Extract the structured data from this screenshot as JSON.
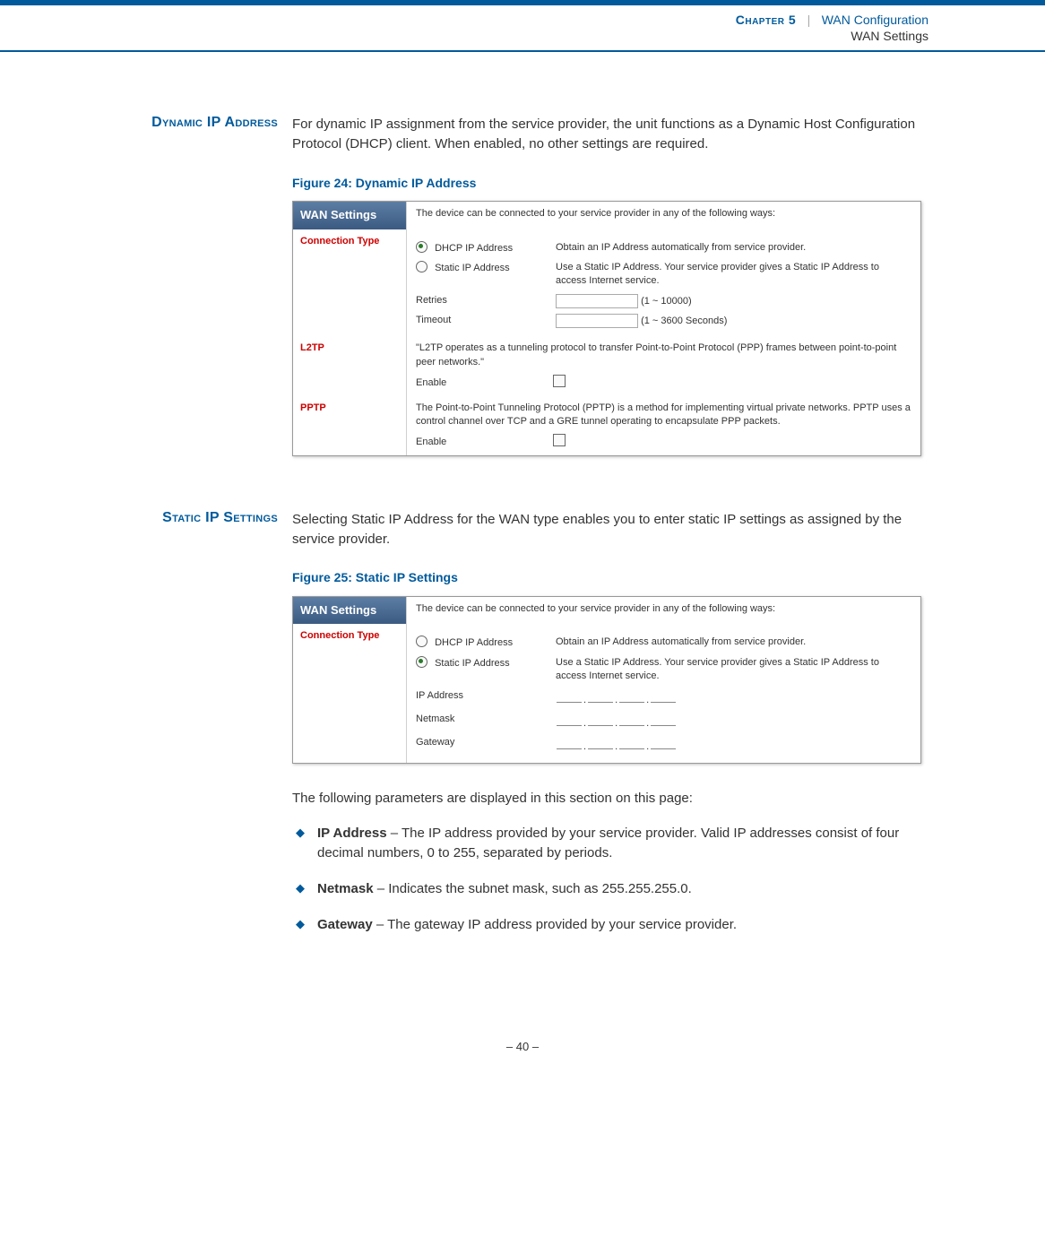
{
  "header": {
    "chapter": "Chapter 5",
    "separator": "|",
    "title1": "WAN Configuration",
    "title2": "WAN Settings"
  },
  "sec1": {
    "heading": "Dynamic IP Address",
    "body": "For dynamic IP assignment from the service provider, the unit functions as a Dynamic Host Configuration Protocol (DHCP) client. When enabled, no other settings are required.",
    "figcap": "Figure 24:  Dynamic IP Address"
  },
  "ss1": {
    "title": "WAN Settings",
    "intro": "The device can be connected to your service provider in any of the following ways:",
    "conn_label": "Connection Type",
    "dhcp_label": "DHCP IP Address",
    "dhcp_desc": "Obtain an IP Address automatically from service provider.",
    "static_label": "Static IP Address",
    "static_desc": "Use a Static IP Address. Your service provider gives a Static IP Address to access Internet service.",
    "retries_label": "Retries",
    "retries_hint": "(1 ~ 10000)",
    "timeout_label": "Timeout",
    "timeout_hint": "(1 ~ 3600 Seconds)",
    "l2tp_label": "L2TP",
    "l2tp_desc": "\"L2TP operates as a tunneling protocol to transfer Point-to-Point Protocol (PPP) frames between point-to-point peer networks.\"",
    "enable_label": "Enable",
    "pptp_label": "PPTP",
    "pptp_desc": "The Point-to-Point Tunneling Protocol (PPTP) is a method for implementing virtual private networks. PPTP uses a control channel over TCP and a GRE tunnel operating to encapsulate PPP packets."
  },
  "sec2": {
    "heading": "Static IP Settings",
    "body": "Selecting Static IP Address for the WAN type enables you to enter static IP settings as assigned by the service provider.",
    "figcap": "Figure 25:  Static IP Settings",
    "intro2": "The following parameters are displayed in this section on this page:"
  },
  "ss2": {
    "title": "WAN Settings",
    "intro": "The device can be connected to your service provider in any of the following ways:",
    "conn_label": "Connection Type",
    "dhcp_label": "DHCP IP Address",
    "dhcp_desc": "Obtain an IP Address automatically from service provider.",
    "static_label": "Static IP Address",
    "static_desc": "Use a Static IP Address. Your service provider gives a Static IP Address to access Internet service.",
    "ip_label": "IP Address",
    "netmask_label": "Netmask",
    "gateway_label": "Gateway"
  },
  "params": {
    "ip_name": "IP Address",
    "ip_desc": " – The IP address provided by your service provider. Valid IP addresses consist of four decimal numbers, 0 to 255, separated by periods.",
    "nm_name": "Netmask",
    "nm_desc": " – Indicates the subnet mask, such as 255.255.255.0.",
    "gw_name": "Gateway",
    "gw_desc": " – The gateway IP address provided by your service provider."
  },
  "footer": {
    "page": "–  40  –"
  },
  "chart_data": null
}
